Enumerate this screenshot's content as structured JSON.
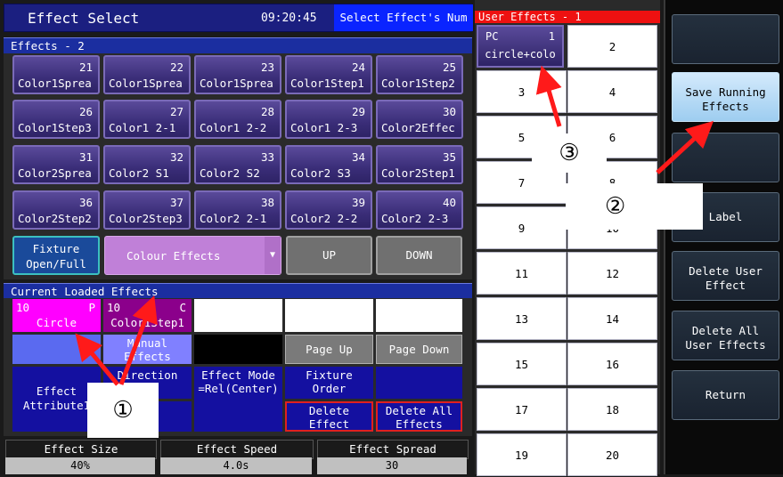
{
  "header": {
    "title": "Effect Select",
    "clock": "09:20:45",
    "hint": "Select Effect's Num"
  },
  "effects": {
    "section_label": "Effects - 2",
    "buttons": [
      {
        "num": "21",
        "label": "Color1Sprea"
      },
      {
        "num": "22",
        "label": "Color1Sprea"
      },
      {
        "num": "23",
        "label": "Color1Sprea"
      },
      {
        "num": "24",
        "label": "Color1Step1"
      },
      {
        "num": "25",
        "label": "Color1Step2"
      },
      {
        "num": "26",
        "label": "Color1Step3"
      },
      {
        "num": "27",
        "label": "Color1 2-1"
      },
      {
        "num": "28",
        "label": "Color1 2-2"
      },
      {
        "num": "29",
        "label": "Color1 2-3"
      },
      {
        "num": "30",
        "label": "Color2Effec"
      },
      {
        "num": "31",
        "label": "Color2Sprea"
      },
      {
        "num": "32",
        "label": "Color2 S1"
      },
      {
        "num": "33",
        "label": "Color2 S2"
      },
      {
        "num": "34",
        "label": "Color2 S3"
      },
      {
        "num": "35",
        "label": "Color2Step1"
      },
      {
        "num": "36",
        "label": "Color2Step2"
      },
      {
        "num": "37",
        "label": "Color2Step3"
      },
      {
        "num": "38",
        "label": "Color2 2-1"
      },
      {
        "num": "39",
        "label": "Color2 2-2"
      },
      {
        "num": "40",
        "label": "Color2 2-3"
      }
    ],
    "fixture_label_1": "Fixture",
    "fixture_label_2": "Open/Full",
    "category_value": "Colour Effects",
    "up_label": "UP",
    "down_label": "DOWN"
  },
  "current": {
    "section_label": "Current Loaded Effects",
    "slot1": {
      "num": "10",
      "flag": "P",
      "label": "Circle"
    },
    "slot2": {
      "num": "10",
      "flag": "C",
      "label": "Color1Step1"
    },
    "manual_1": "Manual",
    "manual_2": "Effects",
    "page_up": "Page Up",
    "page_down": "Page Down",
    "effect_attr_1": "Effect",
    "effect_attr_2": "Attribute1",
    "direction_1": "Direction",
    "direction_2": "=>",
    "mode_1": "Effect Mode",
    "mode_2": "=Rel(Center)",
    "order_1": "Fixture",
    "order_2": "Order",
    "delete_1": "Delete",
    "delete_2": "Effect",
    "delete_all_1": "Delete All",
    "delete_all_2": "Effects"
  },
  "footer": {
    "size_title": "Effect Size",
    "size_value": "40%",
    "speed_title": "Effect Speed",
    "speed_value": "4.0s",
    "spread_title": "Effect Spread",
    "spread_value": "30"
  },
  "user_effects": {
    "header": "User Effects - 1",
    "first": {
      "tag": "PC",
      "num": "1",
      "label": "circle+colo"
    },
    "cells": [
      "2",
      "3",
      "4",
      "5",
      "6",
      "7",
      "8",
      "9",
      "10",
      "11",
      "12",
      "13",
      "14",
      "15",
      "16",
      "17",
      "18",
      "19",
      "20"
    ]
  },
  "side": {
    "save_1": "Save Running",
    "save_2": "Effects",
    "label": "Label",
    "delete_user_1": "Delete User",
    "delete_user_2": "Effect",
    "delete_all_user_1": "Delete All",
    "delete_all_user_2": "User Effects",
    "return": "Return"
  },
  "annotations": {
    "m1": "①",
    "m2": "②",
    "m3": "③"
  },
  "colors": {
    "header_blue": "#1b1f80",
    "hint_blue": "#0a24ff",
    "magenta": "#ff00ff",
    "purple": "#8b008b",
    "arrow_red": "#ff1a1a"
  }
}
